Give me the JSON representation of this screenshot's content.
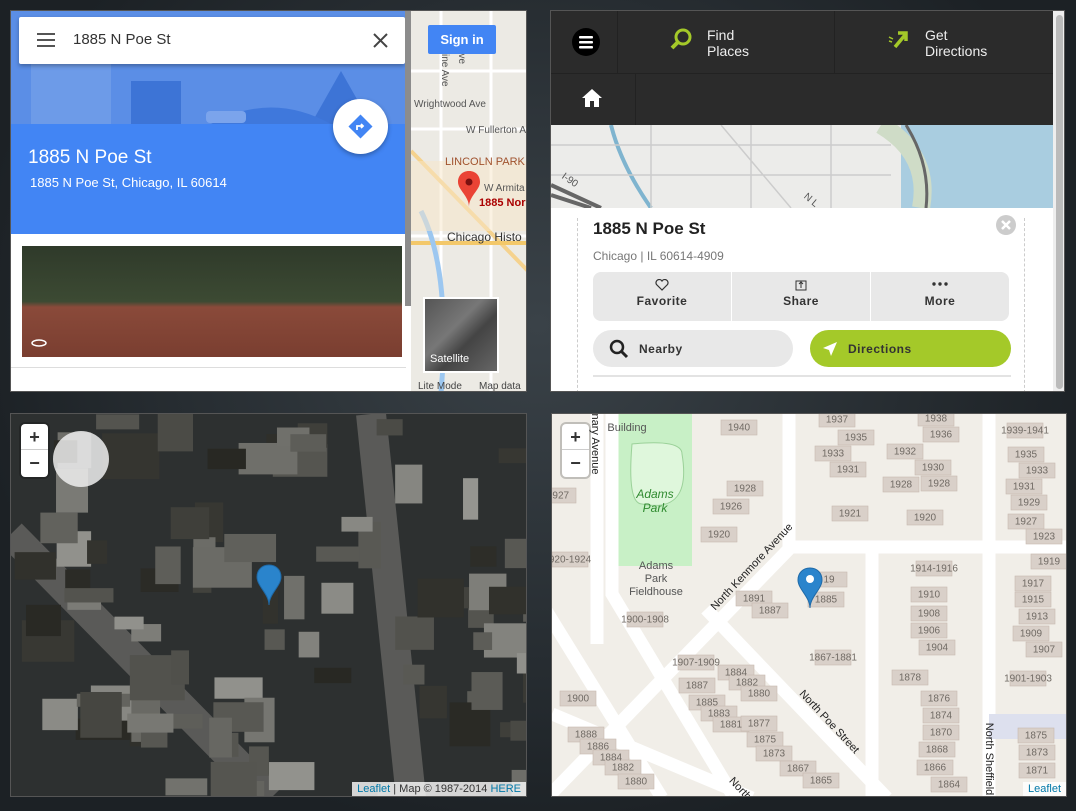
{
  "google": {
    "search_value": "1885 N Poe St",
    "place_title": "1885 N Poe St",
    "place_address": "1885 N Poe St, Chicago, IL 60614",
    "sign_in": "Sign in",
    "satellite_label": "Satellite",
    "lite_mode": "Lite Mode",
    "map_data": "Map data ©",
    "map_labels": [
      "Wrightwood Ave",
      "W Fullerton A",
      "LINCOLN PARK",
      "W Armita",
      "1885 Nor",
      "Chicago Histo",
      "cine Ave",
      "Ave"
    ],
    "accent": "#4285f4"
  },
  "mapquest": {
    "find_places": [
      "Find",
      "Places"
    ],
    "get_directions": [
      "Get",
      "Directions"
    ],
    "map_labels": [
      "I-90",
      "N L"
    ],
    "place_title": "1885 N Poe St",
    "place_sub": "Chicago | IL 60614-4909",
    "actions": [
      {
        "label": "Favorite",
        "icon": "heart-icon"
      },
      {
        "label": "Share",
        "icon": "share-icon"
      },
      {
        "label": "More",
        "icon": "more-icon"
      }
    ],
    "nearby": "Nearby",
    "directions": "Directions",
    "accent": "#a4c929"
  },
  "satellite": {
    "zoom_in": "+",
    "zoom_out": "−",
    "attr_leaflet": "Leaflet",
    "attr_text": " | Map © 1987-2014 ",
    "attr_here": "HERE"
  },
  "osm": {
    "zoom_in": "+",
    "zoom_out": "−",
    "attr_leaflet": "Leaflet",
    "streets": [
      "North Kenmore Avenue",
      "North Poe Street",
      "nary Avenue",
      "North Sheffield",
      "North"
    ],
    "park": [
      "Building",
      "Adams",
      "Park",
      "Adams",
      "Park",
      "Fieldhouse"
    ],
    "house_numbers": [
      "1940",
      "1937",
      "1935",
      "1933",
      "1931",
      "1938",
      "1936",
      "1932",
      "1930",
      "1928",
      "1928",
      "1921",
      "1920",
      "1939-1941",
      "1935",
      "1933",
      "1931",
      "1929",
      "1927",
      "1923",
      "1919",
      "1917",
      "1915",
      "1913",
      "1909",
      "1907",
      "1901-1903",
      "1875",
      "1873",
      "1871",
      "1928",
      "1926",
      "1920",
      "1914-1916",
      "1910",
      "1908",
      "1906",
      "1904",
      "1878",
      "1876",
      "1874",
      "1870",
      "1868",
      "1866",
      "1864",
      "1891",
      "1887",
      "1885",
      "1867-1881",
      "1907-1909",
      "1884",
      "1882",
      "1880",
      "1887",
      "1885",
      "1883",
      "1881",
      "1877",
      "1875",
      "1873",
      "1867",
      "1865",
      "1900",
      "1888",
      "1886",
      "1884",
      "1882",
      "1880",
      "1900-1908",
      "1927",
      "920-1924",
      "19"
    ]
  }
}
